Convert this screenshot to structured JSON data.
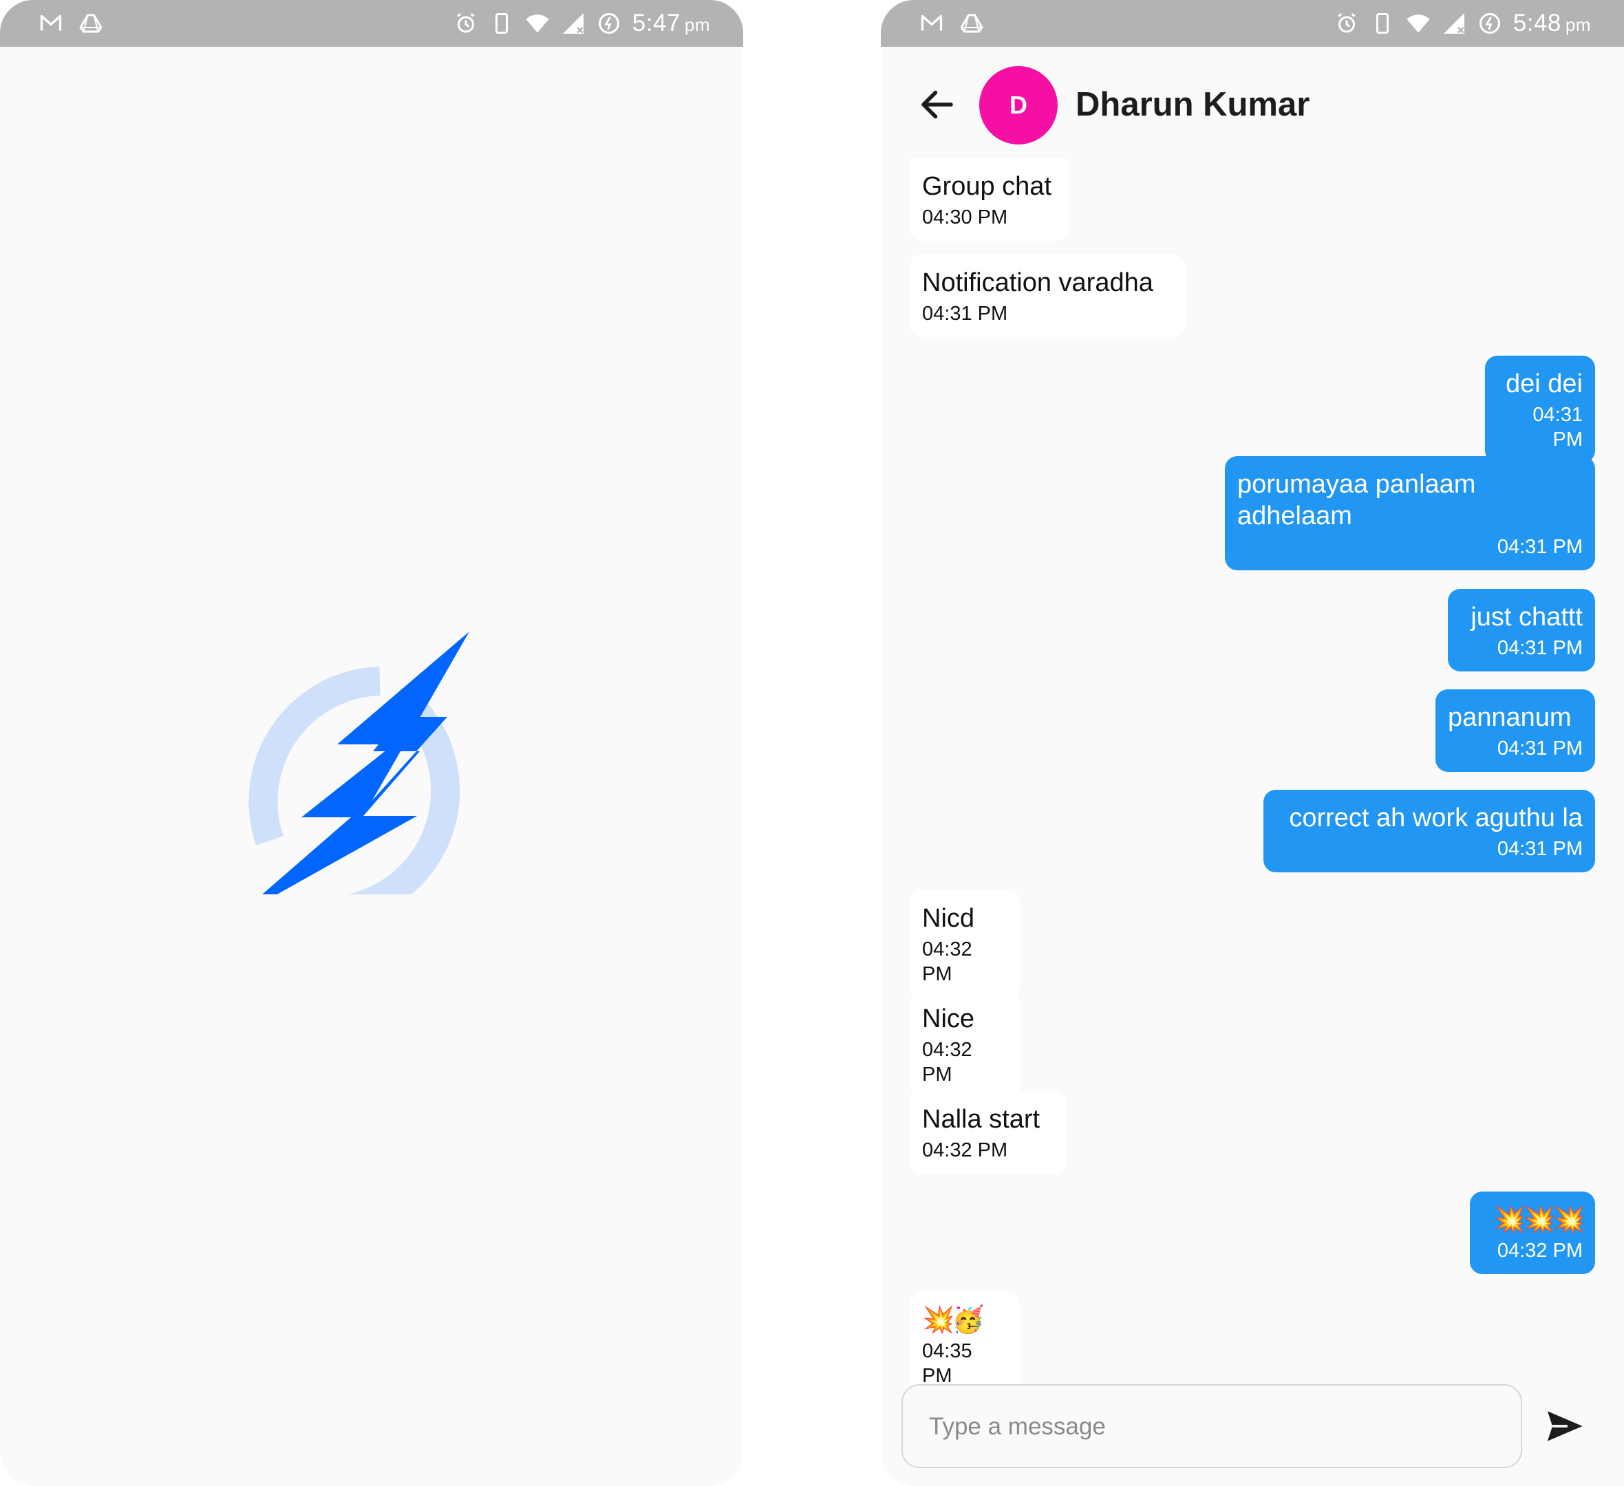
{
  "left_screen": {
    "status_bar": {
      "time": "5:47",
      "ampm": "pm"
    }
  },
  "right_screen": {
    "status_bar": {
      "time": "5:48",
      "ampm": "pm"
    },
    "header": {
      "avatar_initial": "D",
      "contact_name": "Dharun Kumar"
    },
    "messages": [
      {
        "dir": "in",
        "text": "Group chat",
        "time": "04:30 PM"
      },
      {
        "dir": "in",
        "text": "Notification varadha",
        "time": "04:31 PM"
      },
      {
        "dir": "out",
        "text": "dei dei",
        "time": "04:31 PM"
      },
      {
        "dir": "out",
        "text": "porumayaa panlaam adhelaam",
        "time": "04:31 PM"
      },
      {
        "dir": "out",
        "text": "just chattt",
        "time": "04:31 PM"
      },
      {
        "dir": "out",
        "text": "pannanum",
        "time": "04:31 PM"
      },
      {
        "dir": "out",
        "text": "correct ah work aguthu la",
        "time": "04:31 PM"
      },
      {
        "dir": "in",
        "text": "Nicd",
        "time": "04:32 PM"
      },
      {
        "dir": "in",
        "text": "Nice",
        "time": "04:32 PM"
      },
      {
        "dir": "in",
        "text": "Nalla start",
        "time": "04:32 PM"
      },
      {
        "dir": "out",
        "text": "💥💥💥",
        "time": "04:32 PM"
      },
      {
        "dir": "in",
        "text": "💥🥳",
        "time": "04:35 PM"
      }
    ],
    "composer": {
      "placeholder": "Type a message"
    }
  },
  "colors": {
    "status_bar": "#b3b3b3",
    "background": "#fafafa",
    "outgoing_bubble": "#2196f3",
    "incoming_bubble": "#ffffff",
    "avatar": "#f50fa5",
    "logo_bolt": "#0066ff",
    "logo_ring": "#cfe0fa"
  },
  "icons": {
    "status_left": [
      "gmail-icon",
      "drive-icon"
    ],
    "status_right": [
      "alarm-icon",
      "vibrate-icon",
      "wifi-icon",
      "signal-icon",
      "battery-saver-icon"
    ],
    "header": [
      "back-arrow-icon"
    ],
    "composer": [
      "send-icon"
    ],
    "splash": [
      "app-logo-bolt-icon"
    ]
  }
}
